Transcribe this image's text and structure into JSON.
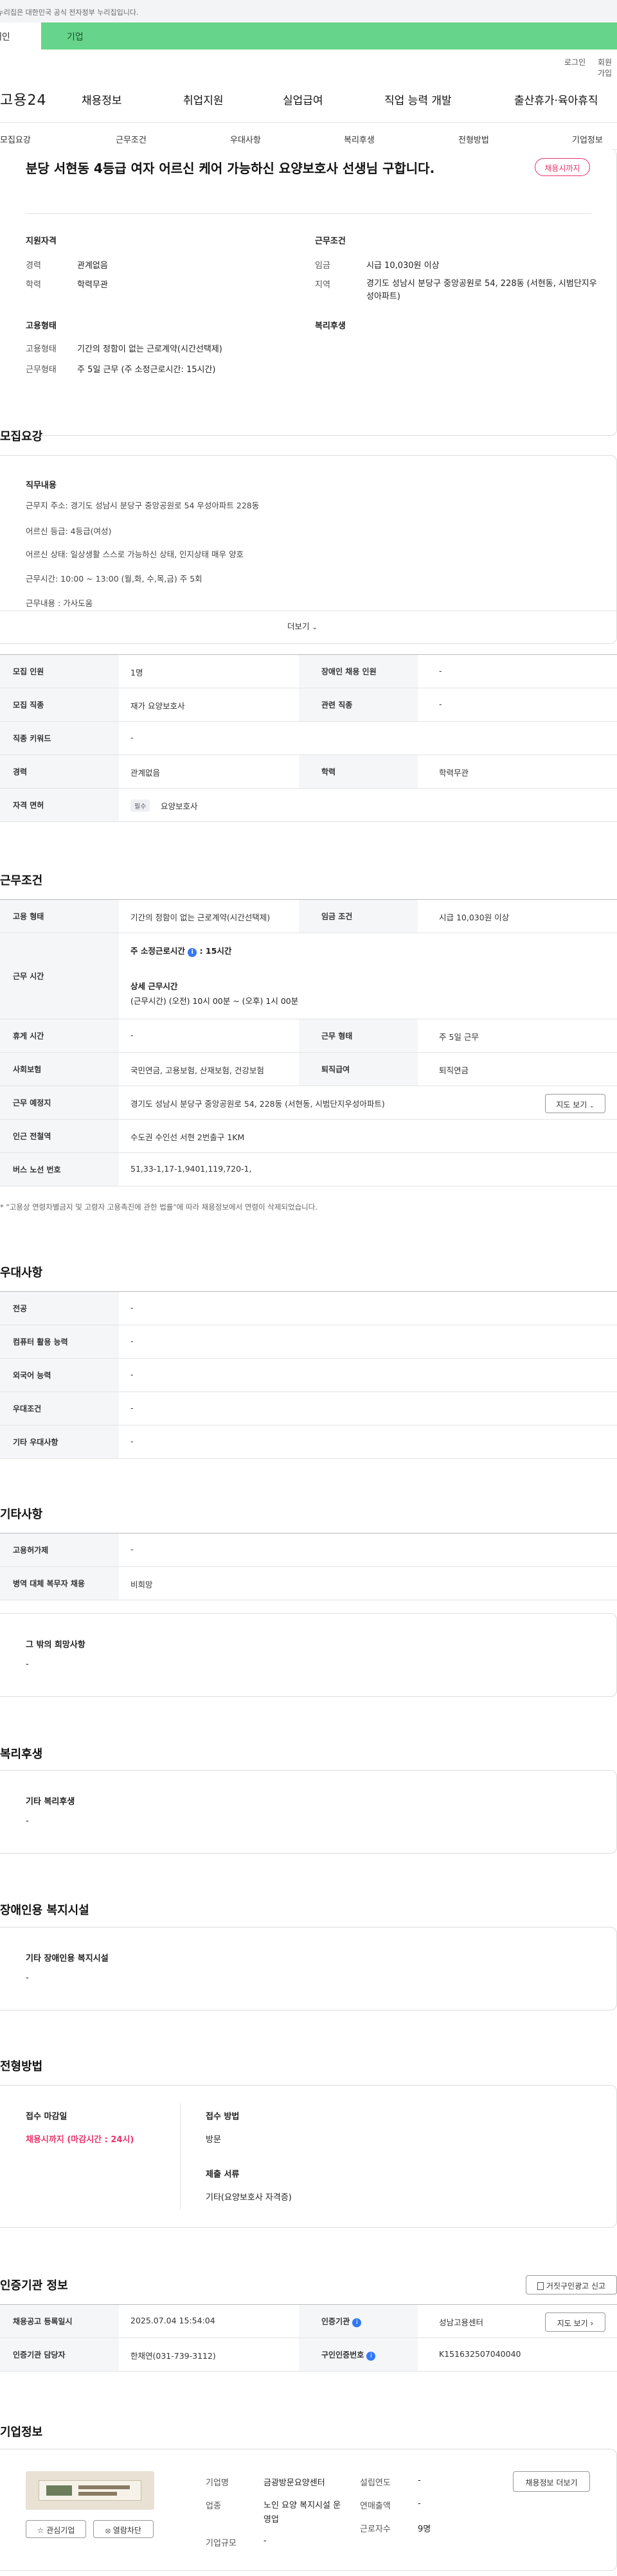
{
  "top": {
    "gov_text": "이 누리집은 대한민국 공식 전자정부 누리집입니다.",
    "seg_individual": "개인",
    "seg_company": "기업",
    "login": "로그인",
    "join": "회원가입"
  },
  "header": {
    "logo": "고용24",
    "nav": [
      "채용정보",
      "취업지원",
      "실업급여",
      "직업 능력 개발",
      "출산휴가·육아휴직"
    ]
  },
  "tabs": [
    "모집요강",
    "근무조건",
    "우대사항",
    "복리후생",
    "전형방법",
    "기업정보"
  ],
  "job": {
    "title": "분당 서현동 4등급 여자 어르신 케어 가능하신 요양보호사 선생님 구합니다.",
    "badge": "채용시까지",
    "qual_head": "지원자격",
    "career_lbl": "경력",
    "career": "관계없음",
    "edu_lbl": "학력",
    "edu": "학력무관",
    "cond_head": "근무조건",
    "wage_lbl": "임금",
    "wage": "시급 10,030원 이상",
    "area_lbl": "지역",
    "area": "경기도 성남시 분당구 중앙공원로 54, 228동 (서현동, 시범단지우성아파트)",
    "emp_head": "고용형태",
    "emp_lbl": "고용형태",
    "emp": "기간의 정함이 없는 근로계약(시간선택제)",
    "work_lbl": "근무형태",
    "work": "주 5일 근무 (주 소정근로시간: 15시간)",
    "welfare_head": "복리후생"
  },
  "recruit": {
    "heading": "모집요강",
    "duty_head": "직무내용",
    "duty_lines": [
      "근무지 주소: 경기도 성남시 분당구 중앙공원로 54 우성아파트 228동",
      "어르신 등급: 4등급(여성)",
      "어르신 상태: 일상생활 스스로 가능하신 상태, 인지상태 매우 양호",
      "근무시간: 10:00 ~ 13:00 (월,화, 수,목,금) 주 5회",
      "근무내용 : 가사도움"
    ],
    "more": "더보기",
    "rows": [
      [
        "모집 인원",
        "1명",
        "장애인 채용 인원",
        "-"
      ],
      [
        "모집 직종",
        "재가 요양보호사",
        "관련 직종",
        "-"
      ],
      [
        "직종 키워드",
        "-",
        "",
        ""
      ],
      [
        "경력",
        "관계없음",
        "학력",
        "학력무관"
      ]
    ],
    "license_lbl": "자격 면허",
    "license_tag": "필수",
    "license": "요양보호사"
  },
  "work": {
    "heading": "근무조건",
    "emp_lbl": "고용 형태",
    "emp": "기간의 정함이 없는 근로계약(시간선택제)",
    "wage_lbl": "임금 조건",
    "wage": "시급 10,030원 이상",
    "time_lbl": "근무 시간",
    "weekly": "주 소정근로시간",
    "weekly_val": ": 15시간",
    "detail_head": "상세 근무시간",
    "detail": "(근무시간) (오전) 10시 00분 ~ (오후) 1시 00분",
    "rest_lbl": "휴게 시간",
    "rest": "-",
    "type_lbl": "근무 형태",
    "type": "주 5일 근무",
    "ins_lbl": "사회보험",
    "ins": "국민연금, 고용보험, 산재보험, 건강보험",
    "ret_lbl": "퇴직급여",
    "ret": "퇴직연금",
    "place_lbl": "근무 예정지",
    "place": "경기도 성남시 분당구 중앙공원로 54, 228동 (서현동, 시범단지우성아파트)",
    "map_btn": "지도 보기",
    "subway_lbl": "인근 전철역",
    "subway": "수도권 수인선 서현 2번출구 1KM",
    "bus_lbl": "버스 노선 번호",
    "bus": "51,33-1,17-1,9401,119,720-1,",
    "note": "* \"고용상 연령차별금지 및 고령자 고용촉진에 관한 법률\"에 따라 채용정보에서 연령이 삭제되었습니다."
  },
  "pref": {
    "heading": "우대사항",
    "rows": [
      [
        "전공",
        "-"
      ],
      [
        "컴퓨터 활용 능력",
        "-"
      ],
      [
        "외국어 능력",
        "-"
      ],
      [
        "우대조건",
        "-"
      ],
      [
        "기타 우대사항",
        "-"
      ]
    ]
  },
  "etc": {
    "heading": "기타사항",
    "rows": [
      [
        "고용허가제",
        "-"
      ],
      [
        "병역 대체 복무자 채용",
        "비희망"
      ]
    ],
    "box_head": "그 밖의 희망사항",
    "box_val": "-"
  },
  "welfare": {
    "heading": "복리후생",
    "head": "기타 복리후생",
    "val": "-"
  },
  "disabled": {
    "heading": "장애인용 복지시설",
    "head": "기타 장애인용 복지시설",
    "val": "-"
  },
  "selection": {
    "heading": "전형방법",
    "deadline_head": "접수 마감일",
    "deadline": "채용시까지 (마감시간 : 24시)",
    "method_head": "접수 방법",
    "method": "방문",
    "docs_head": "제출 서류",
    "docs": "기타(요양보호사 자격증)"
  },
  "cert": {
    "heading": "인증기관 정보",
    "report_btn": "거짓구인광고 신고",
    "reg_lbl": "채용공고 등록일시",
    "reg": "2025.07.04 15:54:04",
    "org_lbl": "인증기관",
    "org": "성남고용센터",
    "map_btn": "지도 보기",
    "mgr_lbl": "인증기관 담당자",
    "mgr": "한채연(031-739-3112)",
    "no_lbl": "구인인증번호",
    "no": "K151632507040040"
  },
  "company": {
    "heading": "기업정보",
    "interest_btn": "관심기업",
    "block_btn": "열람차단",
    "name_lbl": "기업명",
    "name": "금광방문요양센터",
    "ind_lbl": "업종",
    "ind": "노인 요양 복지시설 운영업",
    "size_lbl": "기업규모",
    "size": "-",
    "est_lbl": "설립연도",
    "est": "-",
    "sales_lbl": "연매출액",
    "sales": "-",
    "emp_lbl": "근로자수",
    "emp": "9명",
    "jobs_btn": "채용정보 더보기"
  }
}
